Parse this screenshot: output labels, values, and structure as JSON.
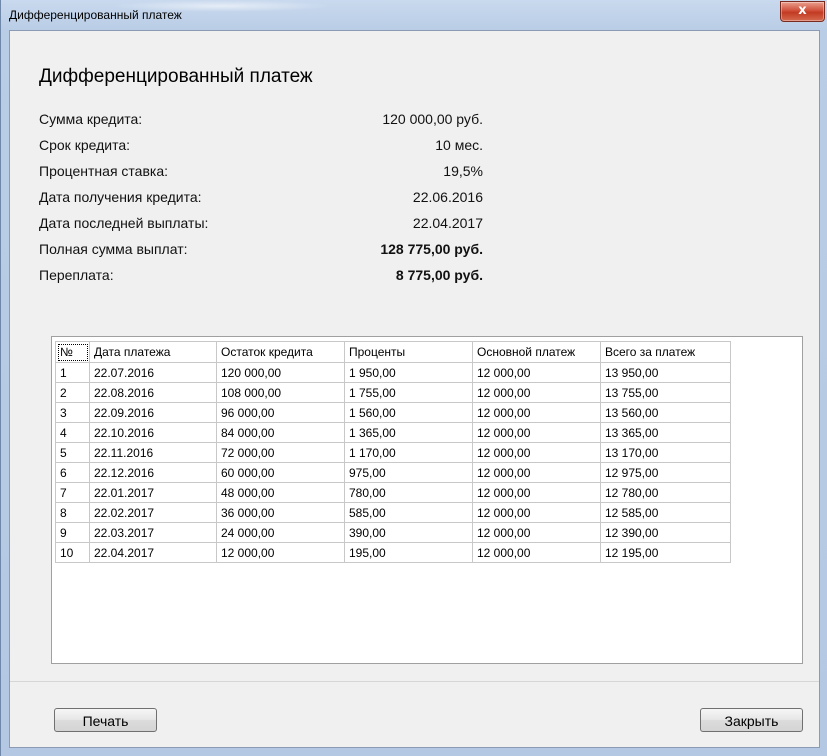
{
  "window": {
    "title": "Дифференцированный платеж",
    "close_glyph": "x"
  },
  "heading": "Дифференцированный платеж",
  "summary": [
    {
      "label": "Сумма кредита:",
      "value": "120 000,00 руб.",
      "bold": false
    },
    {
      "label": "Срок кредита:",
      "value": "10 мес.",
      "bold": false
    },
    {
      "label": "Процентная ставка:",
      "value": "19,5%",
      "bold": false
    },
    {
      "label": "Дата получения кредита:",
      "value": "22.06.2016",
      "bold": false
    },
    {
      "label": "Дата последней выплаты:",
      "value": "22.04.2017",
      "bold": false
    },
    {
      "label": "Полная сумма выплат:",
      "value": "128 775,00 руб.",
      "bold": true
    },
    {
      "label": "Переплата:",
      "value": "8 775,00 руб.",
      "bold": true
    }
  ],
  "table": {
    "columns": [
      "№",
      "Дата платежа",
      "Остаток кредита",
      "Проценты",
      "Основной платеж",
      "Всего за платеж"
    ],
    "rows": [
      [
        "1",
        "22.07.2016",
        "120 000,00",
        "1 950,00",
        "12 000,00",
        "13 950,00"
      ],
      [
        "2",
        "22.08.2016",
        "108 000,00",
        "1 755,00",
        "12 000,00",
        "13 755,00"
      ],
      [
        "3",
        "22.09.2016",
        "96 000,00",
        "1 560,00",
        "12 000,00",
        "13 560,00"
      ],
      [
        "4",
        "22.10.2016",
        "84 000,00",
        "1 365,00",
        "12 000,00",
        "13 365,00"
      ],
      [
        "5",
        "22.11.2016",
        "72 000,00",
        "1 170,00",
        "12 000,00",
        "13 170,00"
      ],
      [
        "6",
        "22.12.2016",
        "60 000,00",
        "975,00",
        "12 000,00",
        "12 975,00"
      ],
      [
        "7",
        "22.01.2017",
        "48 000,00",
        "780,00",
        "12 000,00",
        "12 780,00"
      ],
      [
        "8",
        "22.02.2017",
        "36 000,00",
        "585,00",
        "12 000,00",
        "12 585,00"
      ],
      [
        "9",
        "22.03.2017",
        "24 000,00",
        "390,00",
        "12 000,00",
        "12 390,00"
      ],
      [
        "10",
        "22.04.2017",
        "12 000,00",
        "195,00",
        "12 000,00",
        "12 195,00"
      ]
    ]
  },
  "buttons": {
    "print": "Печать",
    "close": "Закрыть"
  }
}
